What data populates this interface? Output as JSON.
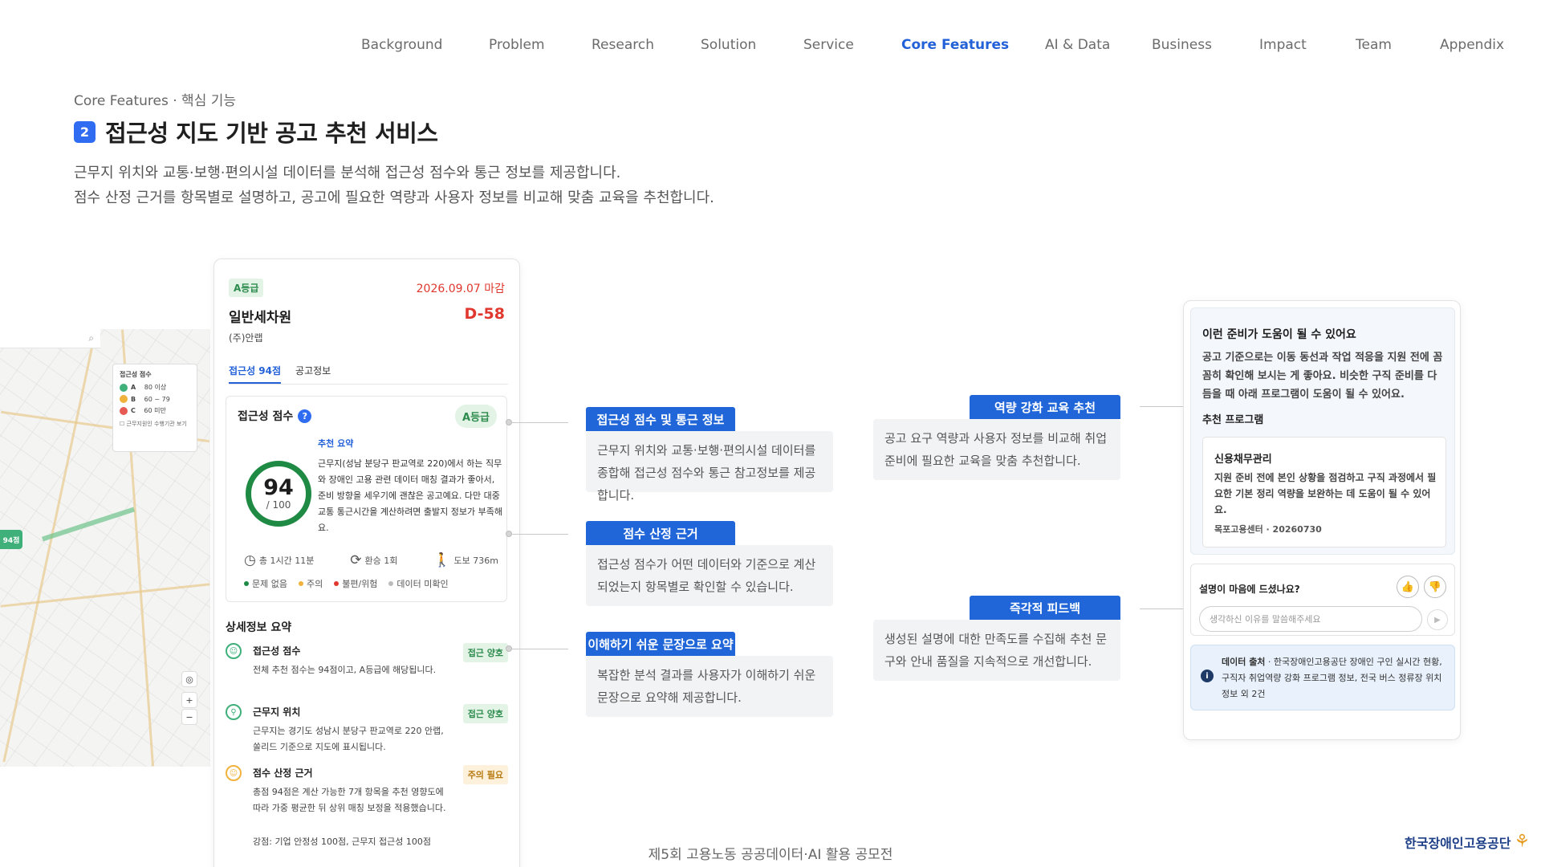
{
  "nav": {
    "items": [
      "Background",
      "Problem",
      "Research",
      "Solution",
      "Service",
      "Core Features",
      "AI & Data",
      "Business",
      "Impact",
      "Team",
      "Appendix"
    ],
    "active": "Core Features"
  },
  "header": {
    "eyebrow": "Core Features · 핵심 기능",
    "number": "2",
    "title": "접근성 지도 기반 공고 추천 서비스",
    "desc1": "근무지 위치와 교통·보행·편의시설 데이터를 분석해 접근성 점수와 통근 정보를 제공합니다.",
    "desc2": "점수 산정 근거를 항목별로 설명하고, 공고에 필요한 역량과 사용자 정보를 비교해 맞춤 교육을 추천합니다."
  },
  "map": {
    "legend_title": "접근성 점수",
    "legend": [
      {
        "grade": "A",
        "range": "80 이상",
        "color": "#3fb07a"
      },
      {
        "grade": "B",
        "range": "60 ~ 79",
        "color": "#f1b23c"
      },
      {
        "grade": "C",
        "range": "60 미만",
        "color": "#e55a52"
      }
    ],
    "legend_check": "근무지원인 수행기관 보기",
    "badge": "94점"
  },
  "phone": {
    "grade_badge": "A등급",
    "deadline": "2026.09.07 마감",
    "job_title": "일반세차원",
    "dday": "D-58",
    "company": "(주)안랩",
    "tabs": [
      "접근성 94점",
      "공고정보"
    ],
    "score_title": "접근성 점수",
    "score_grade": "A등급",
    "score": "94",
    "score_total": "/ 100",
    "summary_title": "추천 요약",
    "summary_text": "근무지(성남 분당구 판교역로 220)에서 하는 직무와 장애인 고용 관련 데이터 매칭 결과가 좋아서, 준비 방향을 세우기에 괜찮은 공고예요. 다만 대중교통 통근시간을 계산하려면 출발지 정보가 부족해요.",
    "commute": [
      {
        "icon": "clock-icon",
        "glyph": "◷",
        "text": "총 1시간 11분"
      },
      {
        "icon": "transfer-icon",
        "glyph": "⟳",
        "text": "환승 1회"
      },
      {
        "icon": "walk-icon",
        "glyph": "🚶",
        "text": "도보 736m"
      }
    ],
    "status_legend": [
      {
        "text": "문제 없음",
        "color": "#1f8a43"
      },
      {
        "text": "주의",
        "color": "#f1b23c"
      },
      {
        "text": "불편/위험",
        "color": "#e0382e"
      },
      {
        "text": "데이터 미확인",
        "color": "#bbbbbb"
      }
    ],
    "detail_title": "상세정보 요약",
    "details": [
      {
        "label": "접근성 점수",
        "tag": "접근 양호",
        "text": "전체 추천 점수는 94점이고, A등급에 해당됩니다.",
        "status": "good"
      },
      {
        "label": "근무지 위치",
        "tag": "접근 양호",
        "text": "근무지는 경기도 성남시 분당구 판교역로 220 안랩, 쏠리드 기준으로 지도에 표시됩니다.",
        "status": "good"
      },
      {
        "label": "점수 산정 근거",
        "tag": "주의 필요",
        "text": "총점 94점은 계산 가능한 7개 항목을 추천 영향도에 따라 가중 평균한 뒤 상위 매칭 보정을 적용했습니다.",
        "extra": "강점: 기업 안정성 100점, 근무지 접근성 100점",
        "status": "warn"
      }
    ]
  },
  "callouts": [
    {
      "label": "접근성 점수 및 통근 정보",
      "text": "근무지 위치와 교통·보행·편의시설 데이터를 종합해 접근성 점수와 통근 참고정보를 제공합니다."
    },
    {
      "label": "점수 산정 근거",
      "text": "접근성 점수가 어떤 데이터와 기준으로 계산되었는지 항목별로 확인할 수 있습니다."
    },
    {
      "label": "이해하기 쉬운 문장으로 요약",
      "text": "복잡한 분석 결과를 사용자가 이해하기 쉬운 문장으로 요약해 제공합니다."
    },
    {
      "label": "역량 강화 교육 추천",
      "text": "공고 요구 역량과 사용자 정보를 비교해 취업 준비에 필요한 교육을 맞춤 추천합니다."
    },
    {
      "label": "즉각적 피드백",
      "text": "생성된 설명에 대한 만족도를 수집해 추천 문구와 안내 품질을 지속적으로 개선합니다."
    }
  ],
  "right": {
    "heading": "이런 준비가 도움이 될 수 있어요",
    "paragraph": "공고 기준으로는 이동 동선과 작업 적응을 지원 전에 꼼꼼히 확인해 보시는 게 좋아요. 비슷한 구직 준비를 다듬을 때 아래 프로그램이 도움이 될 수 있어요.",
    "sub": "추천 프로그램",
    "program_title": "신용채무관리",
    "program_desc": "지원 준비 전에 본인 상황을 점검하고 구직 과정에서 필요한 기본 정리 역량을 보완하는 데 도움이 될 수 있어요.",
    "program_meta": "목포고용센터 · 20260730",
    "feedback_q": "설명이 마음에 드셨나요?",
    "feedback_placeholder": "생각하신 이유를 말씀해주세요",
    "source_label": "데이터 출처",
    "source_text": " · 한국장애인고용공단 장애인 구인 실시간 현황, 구직자 취업역량 강화 프로그램 정보, 전국 버스 정류장 위치정보 외 2건"
  },
  "footer": {
    "text": "제5회 고용노동 공공데이터·AI 활용 공모전",
    "logo": "한국장애인고용공단"
  }
}
